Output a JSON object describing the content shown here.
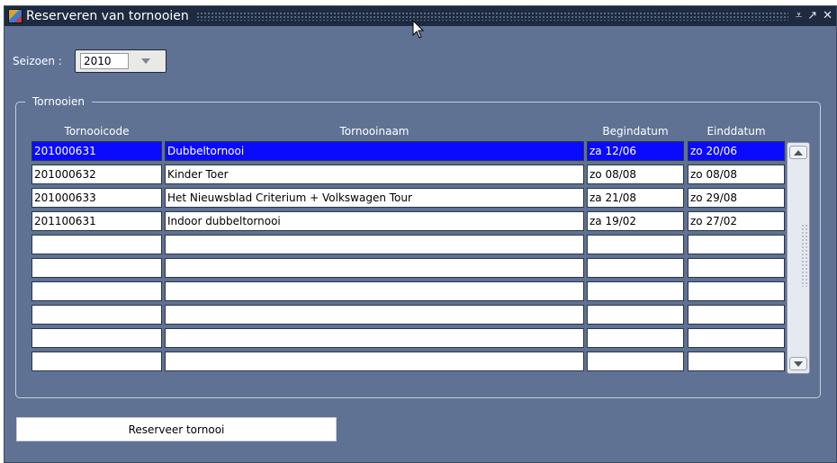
{
  "window": {
    "title": "Reserveren van tornooien",
    "title_buttons": [
      "⩡",
      "↗",
      "✕"
    ]
  },
  "season": {
    "label": "Seizoen :",
    "value": "2010"
  },
  "group": {
    "label": "Tornooien"
  },
  "table": {
    "columns": [
      "Tornooicode",
      "Tornooinaam",
      "Begindatum",
      "Einddatum"
    ],
    "rows": [
      {
        "code": "201000631",
        "name": "Dubbeltornooi",
        "start": "za 12/06",
        "end": "zo 20/06",
        "selected": true
      },
      {
        "code": "201000632",
        "name": "Kinder Toer",
        "start": "zo 08/08",
        "end": "zo 08/08"
      },
      {
        "code": "201000633",
        "name": "Het Nieuwsblad Criterium + Volkswagen Tour",
        "start": "za 21/08",
        "end": "zo 29/08"
      },
      {
        "code": "201100631",
        "name": "Indoor dubbeltornooi",
        "start": "za 19/02",
        "end": "zo 27/02"
      },
      {
        "code": "",
        "name": "",
        "start": "",
        "end": ""
      },
      {
        "code": "",
        "name": "",
        "start": "",
        "end": ""
      },
      {
        "code": "",
        "name": "",
        "start": "",
        "end": ""
      },
      {
        "code": "",
        "name": "",
        "start": "",
        "end": ""
      },
      {
        "code": "",
        "name": "",
        "start": "",
        "end": ""
      },
      {
        "code": "",
        "name": "",
        "start": "",
        "end": ""
      }
    ]
  },
  "actions": {
    "reserve_label": "Reserveer tornooi"
  },
  "icons": {
    "app": "app-icon",
    "minimize": "minimize-icon",
    "maximize": "maximize-icon",
    "close": "close-icon",
    "cursor": "mouse-cursor"
  },
  "colors": {
    "window_bg": "#5f7294",
    "titlebar_bg": "#1e2a3f",
    "selection": "#0a0aff"
  }
}
